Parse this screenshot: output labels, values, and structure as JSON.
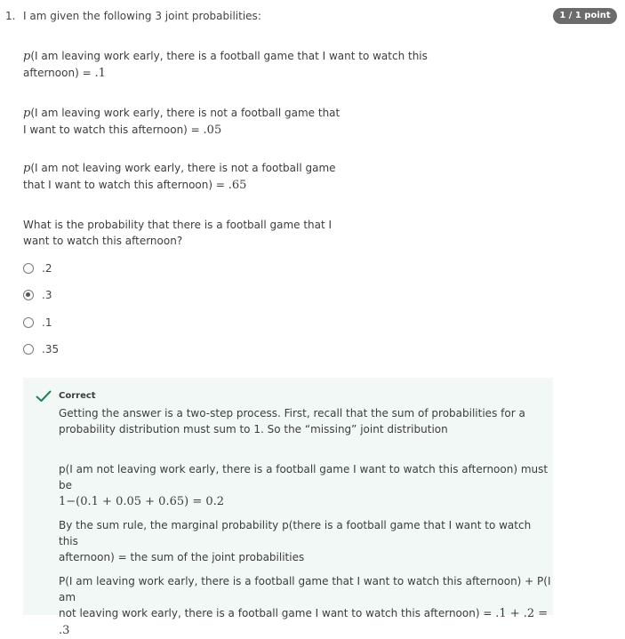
{
  "question": {
    "number": "1.",
    "intro": "I am given the following 3 joint probabilities:",
    "score": "1 / 1 point",
    "p_symbol": "p",
    "prob1_line1": "(I am leaving work early, there is a football game that I want to watch this",
    "prob1_line2": "afternoon) = ",
    "prob1_value": ".1",
    "prob2_line1": "(I am leaving work early, there is not a football game that",
    "prob2_line2": "I want to watch this afternoon) = ",
    "prob2_value": ".05",
    "prob3_line1": "(I am not leaving work early, there is not a football game",
    "prob3_line2": "that I want to watch this afternoon) = ",
    "prob3_value": ".65",
    "prompt_line1": "What is the probability that there is a football game that I",
    "prompt_line2": "want to watch this afternoon?"
  },
  "options": [
    {
      "label": ".2",
      "selected": false
    },
    {
      "label": ".3",
      "selected": true
    },
    {
      "label": ".1",
      "selected": false
    },
    {
      "label": ".35",
      "selected": false
    }
  ],
  "feedback": {
    "status": "Correct",
    "icon": "check-icon",
    "para1_line1": "Getting the answer is a two-step process. First, recall that the sum of probabilities for a",
    "para1_line2": "probability distribution must sum to 1. So the “missing” joint distribution",
    "para2_line1": "p(I am not leaving work early, there is a football game I want to watch this afternoon) must be",
    "para2_math": "1−(0.1 + 0.05 + 0.65) = 0.2",
    "para3_line1": "By the sum rule, the marginal probability p(there is a football game that I want to watch this",
    "para3_line2": "afternoon) = the sum of the joint probabilities",
    "para4_line1": "P(I am leaving work early, there is a football game that I want to watch this afternoon) + P(I am",
    "para4_line2": "not leaving work early, there is a football game I want to watch this afternoon) = ",
    "para4_math": ".1 + .2 = .3"
  },
  "colors": {
    "badge_bg": "#6b6b6b",
    "feedback_bg": "#f1f8f5",
    "check_green": "#1f8354"
  }
}
